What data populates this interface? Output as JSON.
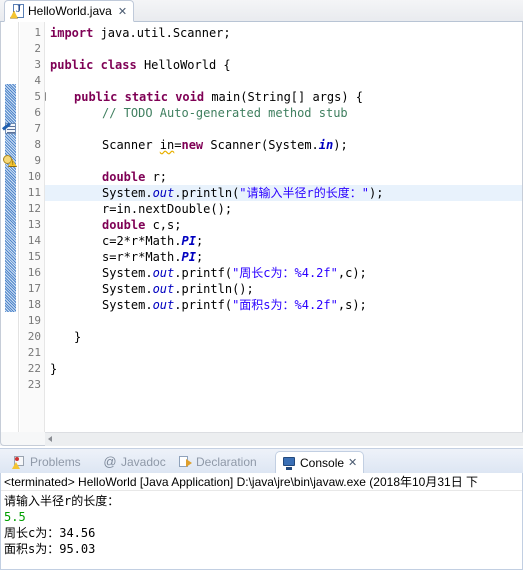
{
  "editor": {
    "tab": {
      "label": "HelloWorld.java",
      "close_label": "✕",
      "icon": "java-file-warning-icon"
    },
    "current_line": 11,
    "lines": [
      {
        "num": "1",
        "text": "import java.util.Scanner;"
      },
      {
        "num": "2",
        "text": ""
      },
      {
        "num": "3",
        "text": "public class HelloWorld {"
      },
      {
        "num": "4",
        "text": ""
      },
      {
        "num": "5",
        "text": "    public static void main(String[] args) {"
      },
      {
        "num": "6",
        "text": "        // TODO Auto-generated method stub"
      },
      {
        "num": "7",
        "text": ""
      },
      {
        "num": "8",
        "text": "        Scanner in=new Scanner(System.in);"
      },
      {
        "num": "9",
        "text": ""
      },
      {
        "num": "10",
        "text": "        double r;"
      },
      {
        "num": "11",
        "text": "        System.out.println(\"请输入半径r的长度：\");"
      },
      {
        "num": "12",
        "text": "        r=in.nextDouble();"
      },
      {
        "num": "13",
        "text": "        double c,s;"
      },
      {
        "num": "14",
        "text": "        c=2*r*Math.PI;"
      },
      {
        "num": "15",
        "text": "        s=r*r*Math.PI;"
      },
      {
        "num": "16",
        "text": "        System.out.printf(\"周长c为：%4.2f\",c);"
      },
      {
        "num": "17",
        "text": "        System.out.println();"
      },
      {
        "num": "18",
        "text": "        System.out.printf(\"面积s为：%4.2f\",s);"
      },
      {
        "num": "19",
        "text": ""
      },
      {
        "num": "20",
        "text": "    }"
      },
      {
        "num": "21",
        "text": ""
      },
      {
        "num": "22",
        "text": "}"
      },
      {
        "num": "23",
        "text": ""
      }
    ],
    "gutter": {
      "todo_marker_line": 6,
      "warning_marker_line": 8,
      "fold_marker_line": 5
    },
    "code_tokens": {
      "line1": {
        "kw": "import",
        "rest": " java.util.Scanner;"
      },
      "line3": {
        "kw1": "public",
        "kw2": "class",
        "rest": " HelloWorld {"
      },
      "line5": {
        "kw1": "public",
        "kw2": "static",
        "kw3": "void",
        "rest": " main(String[] args) {"
      },
      "line6": {
        "comment": "// TODO Auto-generated method stub"
      },
      "line8": {
        "pre": "Scanner ",
        "var": "in",
        "eq": "=",
        "kw": "new",
        "mid": " Scanner(System.",
        "fld": "in",
        "post": ");"
      },
      "line10": {
        "kw": "double",
        "rest": " r;"
      },
      "line11": {
        "pre": "System.",
        "fld": "out",
        "mid": ".println(",
        "str": "\"请输入半径r的长度：\"",
        "post": ");"
      },
      "line12": {
        "text": "r=in.nextDouble();"
      },
      "line13": {
        "kw": "double",
        "rest": " c,s;"
      },
      "line14": {
        "pre": "c=2*r*Math.",
        "fld": "PI",
        "post": ";"
      },
      "line15": {
        "pre": "s=r*r*Math.",
        "fld": "PI",
        "post": ";"
      },
      "line16": {
        "pre": "System.",
        "fld": "out",
        "mid": ".printf(",
        "str": "\"周长c为：%4.2f\"",
        "post": ",c);"
      },
      "line17": {
        "pre": "System.",
        "fld": "out",
        "post": ".println();"
      },
      "line18": {
        "pre": "System.",
        "fld": "out",
        "mid": ".printf(",
        "str": "\"面积s为：%4.2f\"",
        "post": ",s);"
      },
      "line20": {
        "text": "}"
      },
      "line22": {
        "text": "}"
      }
    },
    "scrollbar": {
      "left_arrow": "◀"
    }
  },
  "console_view": {
    "tabs": [
      {
        "label": "Problems",
        "icon": "problems-icon",
        "active": false
      },
      {
        "label": "Javadoc",
        "icon": "javadoc-at-icon",
        "active": false
      },
      {
        "label": "Declaration",
        "icon": "declaration-icon",
        "active": false
      },
      {
        "label": "Console",
        "icon": "console-icon",
        "active": true
      }
    ],
    "close_label": "✕",
    "header": "<terminated> HelloWorld [Java Application] D:\\java\\jre\\bin\\javaw.exe (2018年10月31日 下",
    "output": [
      {
        "text": "请输入半径r的长度：",
        "kind": "stdout"
      },
      {
        "text": "5.5",
        "kind": "stdin"
      },
      {
        "text": "周长c为：34.56",
        "kind": "stdout"
      },
      {
        "text": "面积s为：95.03",
        "kind": "stdout"
      }
    ]
  },
  "colors": {
    "keyword": "#7F0055",
    "string": "#2A00FF",
    "comment": "#3F7F5F",
    "field": "#0000C0",
    "stdin": "#00A000",
    "current_line_highlight": "#E8F2FC"
  }
}
